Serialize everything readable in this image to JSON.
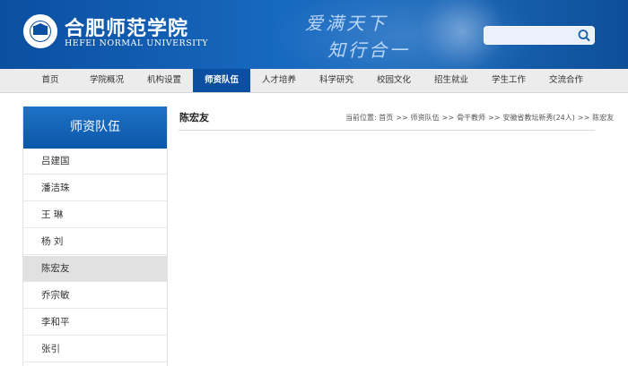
{
  "header": {
    "logo_cn": "合肥师范学院",
    "logo_en": "HEFEI NORMAL UNIVERSITY",
    "slogan_line1": "爱满天下",
    "slogan_line2": "知行合一",
    "search_placeholder": "",
    "search_icon": "search-icon"
  },
  "nav": {
    "items": [
      {
        "label": "首页"
      },
      {
        "label": "学院概况"
      },
      {
        "label": "机构设置"
      },
      {
        "label": "师资队伍"
      },
      {
        "label": "人才培养"
      },
      {
        "label": "科学研究"
      },
      {
        "label": "校园文化"
      },
      {
        "label": "招生就业"
      },
      {
        "label": "学生工作"
      },
      {
        "label": "交流合作"
      }
    ],
    "active": "师资队伍"
  },
  "sidebar": {
    "title": "师资队伍",
    "items": [
      {
        "label": "吕建国"
      },
      {
        "label": "潘洁珠"
      },
      {
        "label": "王  琳"
      },
      {
        "label": "杨  刘"
      },
      {
        "label": "陈宏友"
      },
      {
        "label": "乔宗敏"
      },
      {
        "label": "李和平"
      },
      {
        "label": "张引"
      }
    ],
    "active": "陈宏友"
  },
  "content": {
    "title": "陈宏友",
    "breadcrumb": {
      "prefix": "当前位置:",
      "links": [
        "首页",
        "师资队伍",
        "骨干教师",
        "安徽省教坛新秀(24人)",
        "陈宏友"
      ],
      "separator": ">>"
    }
  },
  "colors": {
    "brand": "#0b4fa0",
    "nav_bg": "#ececec",
    "sidebar_active": "#e1e1e1"
  }
}
